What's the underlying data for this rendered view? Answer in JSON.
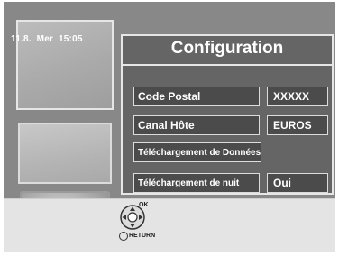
{
  "status": {
    "date": "11.8.",
    "weekday": "Mer",
    "time": "15:05"
  },
  "panel": {
    "title": "Configuration",
    "rows": [
      {
        "label": "Code Postal",
        "value": "XXXXX"
      },
      {
        "label": "Canal Hôte",
        "value": "EUROS"
      },
      {
        "label": "Téléchargement de Données",
        "value": ""
      },
      {
        "label": "Téléchargement de nuit",
        "value": "Oui"
      }
    ]
  },
  "footer": {
    "ok_label": "OK",
    "return_label": "RETURN",
    "nav_icon": "dpad-icon",
    "return_icon": "return-circle-icon"
  },
  "colors": {
    "screen_bg": "#888888",
    "panel_bg": "#656565",
    "row_bg": "#4b4b4b",
    "border": "#e6e6e6",
    "footer_bg": "#e4e4e4"
  }
}
